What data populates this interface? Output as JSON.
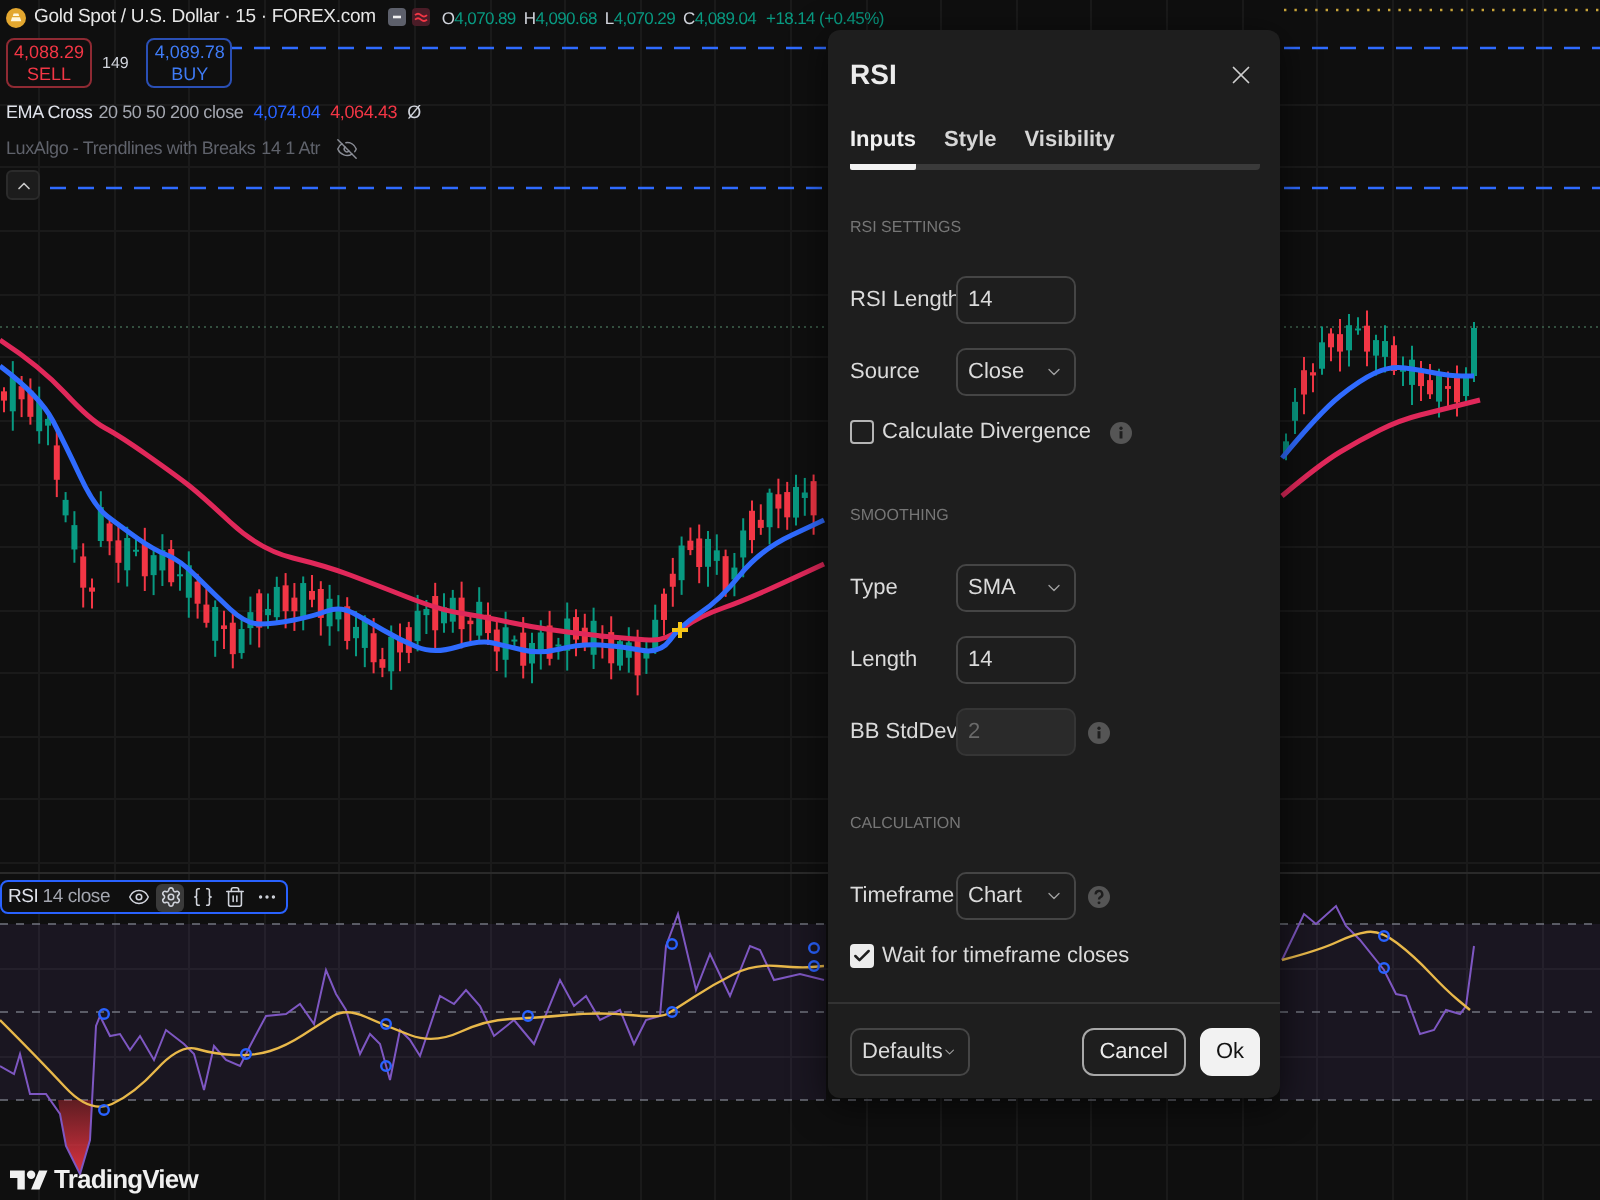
{
  "chart_header": {
    "symbol": "Gold Spot / U.S. Dollar · 15 · FOREX.com",
    "ohlc": [
      {
        "label": "O",
        "value": "4,070.89"
      },
      {
        "label": "H",
        "value": "4,090.68"
      },
      {
        "label": "L",
        "value": "4,070.29"
      },
      {
        "label": "C",
        "value": "4,089.04"
      }
    ],
    "change": "+18.14 (+0.45%)"
  },
  "trade": [
    {
      "kind": "sell",
      "price": "4,088.29",
      "label": "SELL"
    },
    {
      "kind": "spread",
      "label": "149"
    },
    {
      "kind": "buy",
      "price": "4,089.78",
      "label": "BUY"
    }
  ],
  "indicators": [
    {
      "name": "EMA Cross",
      "params": "20 50 50 200 close",
      "hidden": false,
      "values": [
        {
          "text": "4,074.04",
          "color": "#2962ff"
        },
        {
          "text": "4,064.43",
          "color": "#f23645"
        }
      ],
      "suffix": "Ø"
    },
    {
      "name": "LuxAlgo - Trendlines with Breaks",
      "params": "14 1 Atr",
      "hidden": true
    }
  ],
  "rsi_pane": {
    "name": "RSI",
    "params": "14 close",
    "tools": [
      {
        "kind": "visibility",
        "selected": false
      },
      {
        "kind": "settings",
        "selected": true
      },
      {
        "kind": "source",
        "selected": false
      },
      {
        "kind": "delete",
        "selected": false
      },
      {
        "kind": "more",
        "selected": false
      }
    ]
  },
  "branding": {
    "logo_text": "TradingView"
  },
  "dialog": {
    "title": "RSI",
    "tabs": [
      {
        "label": "Inputs",
        "selected": true
      },
      {
        "label": "Style",
        "selected": false
      },
      {
        "label": "Visibility",
        "selected": false
      }
    ],
    "sections": [
      {
        "heading": "RSI SETTINGS",
        "fields": [
          {
            "kind": "input",
            "label": "RSI Length",
            "value": "14",
            "disabled": false,
            "info": false,
            "help": false
          },
          {
            "kind": "select",
            "label": "Source",
            "value": "Close",
            "disabled": false,
            "info": false,
            "help": false
          },
          {
            "kind": "checkbox",
            "label": "Calculate Divergence",
            "checked": false,
            "disabled": false,
            "info": true,
            "help": false
          }
        ]
      },
      {
        "heading": "SMOOTHING",
        "fields": [
          {
            "kind": "select",
            "label": "Type",
            "value": "SMA",
            "disabled": false,
            "info": false,
            "help": false
          },
          {
            "kind": "input",
            "label": "Length",
            "value": "14",
            "disabled": false,
            "info": false,
            "help": false
          },
          {
            "kind": "input",
            "label": "BB StdDev",
            "value": "2",
            "disabled": true,
            "info": true,
            "help": false
          }
        ]
      },
      {
        "heading": "CALCULATION",
        "fields": [
          {
            "kind": "select",
            "label": "Timeframe",
            "value": "Chart",
            "disabled": false,
            "info": false,
            "help": true
          },
          {
            "kind": "checkbox",
            "label": "Wait for timeframe closes",
            "checked": true,
            "disabled": false,
            "info": false,
            "help": false
          }
        ]
      }
    ],
    "defaults": "Defaults",
    "buttons": [
      {
        "kind": "secondary",
        "label": "Cancel"
      },
      {
        "kind": "primary",
        "label": "Ok"
      }
    ]
  }
}
